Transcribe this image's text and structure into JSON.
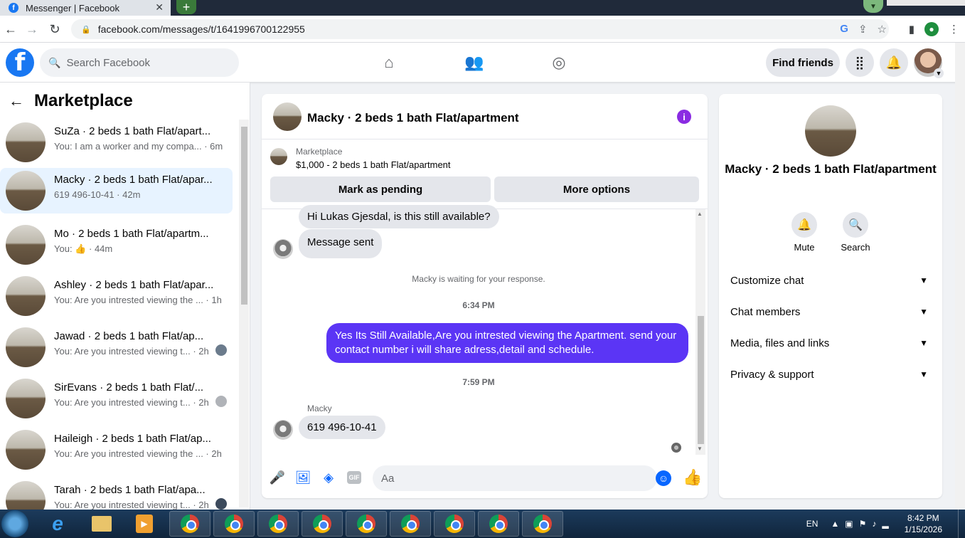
{
  "browser": {
    "tab_title": "Messenger | Facebook",
    "tab_favicon": "f",
    "tab_close": "✕",
    "new_tab": "+",
    "url": "facebook.com/messages/t/1641996700122955"
  },
  "fb": {
    "logo": "f",
    "search_placeholder": "Search Facebook",
    "find_friends": "Find friends"
  },
  "sidebar": {
    "title": "Marketplace",
    "conversations": [
      {
        "name": "SuZa · 2 beds 1 bath Flat/apart...",
        "snippet": "You: I am a worker and my compa... · 6m"
      },
      {
        "name": "Macky · 2 beds 1 bath Flat/apar...",
        "snippet": "619 496-10-41 · 42m"
      },
      {
        "name": "Mo · 2 beds 1 bath Flat/apartm...",
        "snippet_prefix": "You:",
        "snippet": "· 44m"
      },
      {
        "name": "Ashley · 2 beds 1 bath Flat/apar...",
        "snippet": "You: Are you intrested viewing the ... · 1h"
      },
      {
        "name": "Jawad · 2 beds 1 bath Flat/ap...",
        "snippet": "You: Are you intrested viewing t... · 2h"
      },
      {
        "name": "SirEvans · 2 beds 1 bath Flat/...",
        "snippet": "You: Are you intrested viewing t... · 2h"
      },
      {
        "name": "Haileigh · 2 beds 1 bath Flat/ap...",
        "snippet": "You: Are you intrested viewing the ... · 2h"
      },
      {
        "name": "Tarah · 2 beds 1 bath Flat/apa...",
        "snippet": "You: Are you intrested viewing t... · 2h"
      }
    ]
  },
  "chat": {
    "title": "Macky · 2 beds 1 bath Flat/apartment",
    "marketplace_label": "Marketplace",
    "listing": "$1,000 - 2 beds 1 bath Flat/apartment",
    "mark_pending": "Mark as pending",
    "more_options": "More options",
    "messages": {
      "first": "Hi Lukas Gjesdal, is this still available?",
      "sent": "Message sent",
      "waiting": "Macky is waiting for your response.",
      "time1": "6:34 PM",
      "outgoing": "Yes Its Still Available,Are you intrested viewing the Apartment. send your contact number i will share adress,detail and schedule.",
      "time2": "7:59 PM",
      "sender": "Macky",
      "reply": "619 496-10-41"
    },
    "composer_placeholder": "Aa",
    "gif_label": "GIF"
  },
  "info": {
    "name": "Macky · 2 beds 1 bath Flat/apartment",
    "mute": "Mute",
    "search": "Search",
    "menu": [
      "Customize chat",
      "Chat members",
      "Media, files and links",
      "Privacy & support"
    ]
  },
  "taskbar": {
    "lang": "EN",
    "time": "8:42 PM",
    "date": "1/15/2026"
  },
  "colors": {
    "fb_blue": "#1877f2",
    "outgoing_bubble": "#5b35f5",
    "active_conversation": "#e7f3ff",
    "info_icon": "#8a2be2"
  }
}
